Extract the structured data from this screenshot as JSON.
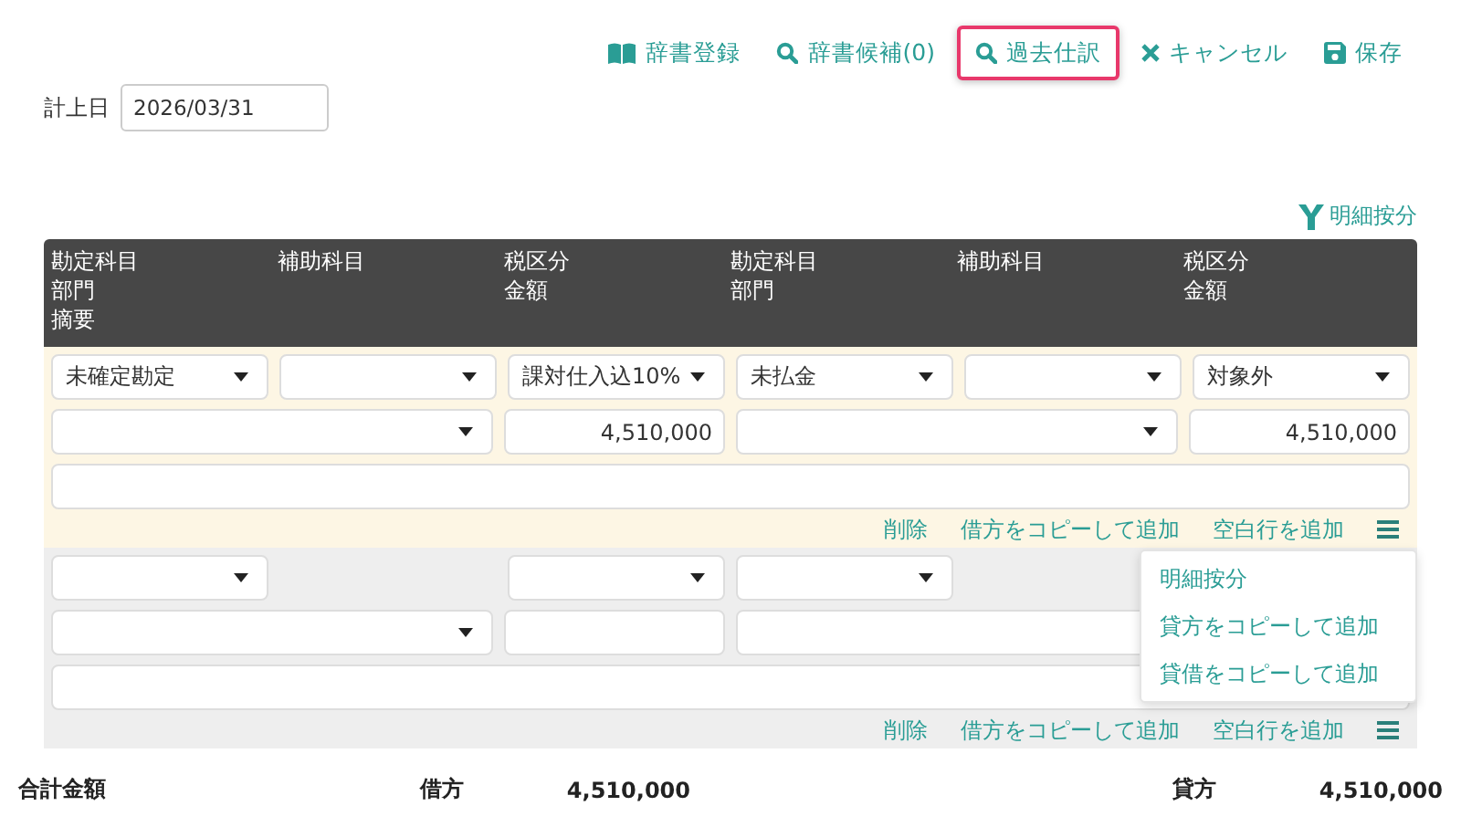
{
  "toolbar": [
    {
      "label": "辞書登録",
      "kind": "book",
      "highlighted": false
    },
    {
      "label": "辞書候補(0)",
      "kind": "search",
      "highlighted": false
    },
    {
      "label": "過去仕訳",
      "kind": "search",
      "highlighted": true
    },
    {
      "label": "キャンセル",
      "kind": "close",
      "highlighted": false
    },
    {
      "label": "保存",
      "kind": "save",
      "highlighted": false
    }
  ],
  "date_field": {
    "label": "計上日",
    "value": "2026/03/31"
  },
  "split_link": {
    "label": "明細按分"
  },
  "header": [
    [
      "勘定科目",
      "部門",
      "摘要"
    ],
    [
      "補助科目"
    ],
    [
      "税区分",
      "金額"
    ],
    [
      "勘定科目",
      "部門"
    ],
    [
      "補助科目"
    ],
    [
      "税区分",
      "金額"
    ]
  ],
  "entries": [
    {
      "selected": true,
      "row1": [
        {
          "kind": "select",
          "value": "未確定勘定"
        },
        {
          "kind": "select"
        },
        {
          "kind": "select",
          "value": "課対仕入込10%"
        },
        {
          "kind": "select",
          "value": "未払金"
        },
        {
          "kind": "select"
        },
        {
          "kind": "select",
          "value": "対象外"
        }
      ],
      "row2": [
        {
          "kind": "select"
        },
        {
          "kind": "input",
          "value": "4,510,000"
        },
        {
          "kind": "select"
        },
        {
          "kind": "input",
          "value": "4,510,000"
        }
      ],
      "memo": {
        "kind": "input"
      },
      "actions": [
        "削除",
        "借方をコピーして追加",
        "空白行を追加"
      ],
      "menu": {
        "open": true,
        "items": [
          "明細按分",
          "貸方をコピーして追加",
          "貸借をコピーして追加"
        ]
      }
    },
    {
      "selected": false,
      "row1": [
        {
          "kind": "select"
        },
        {
          "kind": "none"
        },
        {
          "kind": "select"
        },
        {
          "kind": "select"
        }
      ],
      "row2": [
        {
          "kind": "select"
        },
        {
          "kind": "input"
        },
        {
          "kind": "input"
        }
      ],
      "memo": {
        "kind": "input"
      },
      "actions": [
        "削除",
        "借方をコピーして追加",
        "空白行を追加"
      ]
    }
  ],
  "totals": {
    "label": "合計金額",
    "debit_label": "借方",
    "debit": "4,510,000",
    "credit_label": "貸方",
    "credit": "4,510,000"
  }
}
